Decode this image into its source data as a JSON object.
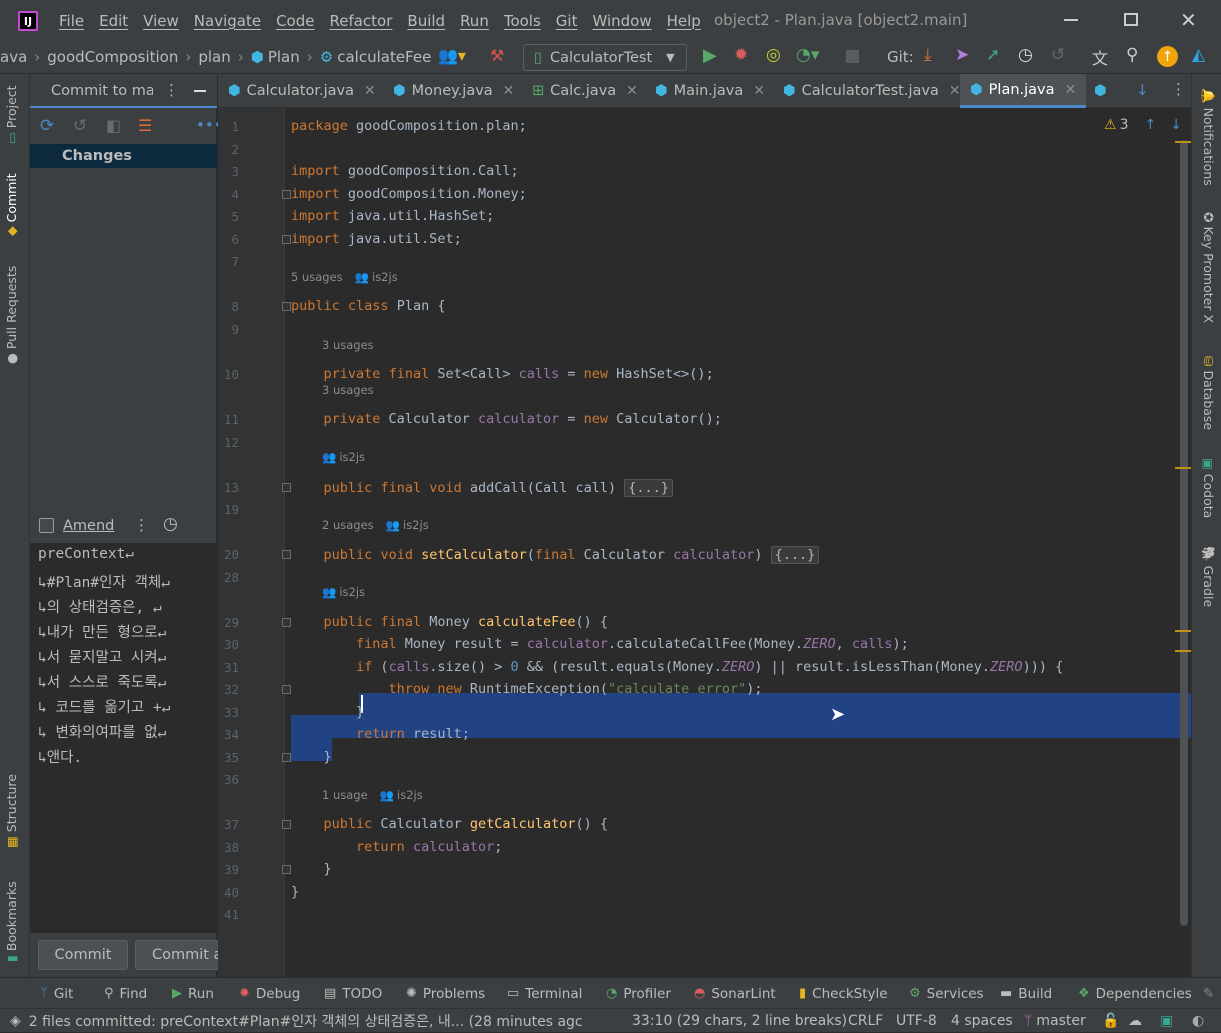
{
  "window": {
    "title": "object2 - Plan.java [object2.main]"
  },
  "menu": [
    "File",
    "Edit",
    "View",
    "Navigate",
    "Code",
    "Refactor",
    "Build",
    "Run",
    "Tools",
    "Git",
    "Window",
    "Help"
  ],
  "breadcrumb": [
    "ava",
    "goodComposition",
    "plan",
    "Plan",
    "calculateFee"
  ],
  "run_config": "CalculatorTest",
  "git_label": "Git:",
  "tabs": {
    "commit_panel_tab": "Commit to ma:",
    "files": [
      "Calculator.java",
      "Money.java",
      "Calc.java",
      "Main.java",
      "CalculatorTest.java",
      "Plan.java"
    ],
    "active": "Plan.java"
  },
  "left_strip": {
    "project": "Project",
    "commit": "Commit",
    "pull_requests": "Pull Requests",
    "structure": "Structure",
    "bookmarks": "Bookmarks"
  },
  "right_strip": {
    "notifications": "Notifications",
    "key_promoter": "Key Promoter X",
    "database": "Database",
    "codota": "Codota",
    "gradle": "Gradle"
  },
  "commit_panel": {
    "changes_label": "Changes",
    "amend_label": "Amend",
    "message_lines": [
      "preContext↵",
      "↳#Plan#인자 객체↵",
      "↳의 상태검증은, ↵",
      "↳내가 만든 형으로↵",
      "↳서 묻지말고 시켜↵",
      "↳서 스스로 죽도록↵",
      "↳ 코드를 옮기고 +↵",
      "↳ 변화의여파를 없↵",
      "↳앤다."
    ],
    "commit_button": "Commit",
    "commit_push_button": "Commit a"
  },
  "editor": {
    "warnings_count": "3",
    "inlay": {
      "usages_5": "5 usages",
      "author": "is2js",
      "usages_3": "3 usages",
      "usages_2": "2 usages",
      "usage_1": "1 usage"
    },
    "lines": [
      {
        "n": "1",
        "t": "package goodComposition.plan;"
      },
      {
        "n": "2",
        "t": ""
      },
      {
        "n": "3",
        "t": "import goodComposition.Call;"
      },
      {
        "n": "4",
        "t": "import goodComposition.Money;"
      },
      {
        "n": "5",
        "t": "import java.util.HashSet;"
      },
      {
        "n": "6",
        "t": "import java.util.Set;"
      },
      {
        "n": "7",
        "t": ""
      },
      {
        "n": "8",
        "t": "public class Plan {"
      },
      {
        "n": "9",
        "t": ""
      },
      {
        "n": "10",
        "t": "    private final Set<Call> calls = new HashSet<>();"
      },
      {
        "n": "11",
        "t": "    private Calculator calculator = new Calculator();"
      },
      {
        "n": "12",
        "t": ""
      },
      {
        "n": "13",
        "t": "    public final void addCall(Call call) {...}"
      },
      {
        "n": "19",
        "t": ""
      },
      {
        "n": "20",
        "t": "    public void setCalculator(final Calculator calculator) {...}"
      },
      {
        "n": "28",
        "t": ""
      },
      {
        "n": "29",
        "t": "    public final Money calculateFee() {"
      },
      {
        "n": "30",
        "t": "        final Money result = calculator.calculateCallFee(Money.ZERO, calls);"
      },
      {
        "n": "31",
        "t": "        if (calls.size() > 0 && (result.equals(Money.ZERO) || result.isLessThan(Money.ZERO))) {"
      },
      {
        "n": "32",
        "t": "            throw new RuntimeException(\"calculate error\");"
      },
      {
        "n": "33",
        "t": "        }"
      },
      {
        "n": "34",
        "t": "        return result;"
      },
      {
        "n": "35",
        "t": "    }"
      },
      {
        "n": "36",
        "t": ""
      },
      {
        "n": "37",
        "t": "    public Calculator getCalculator() {"
      },
      {
        "n": "38",
        "t": "        return calculator;"
      },
      {
        "n": "39",
        "t": "    }"
      },
      {
        "n": "40",
        "t": "}"
      },
      {
        "n": "41",
        "t": ""
      }
    ]
  },
  "tool_windows": [
    "Git",
    "Find",
    "Run",
    "Debug",
    "TODO",
    "Problems",
    "Terminal",
    "Profiler",
    "SonarLint",
    "CheckStyle",
    "Services",
    "Build",
    "Dependencies"
  ],
  "status": {
    "message": "2 files committed: preContext#Plan#인자 객체의 상태검증은, 내... (28 minutes agc",
    "position": "33:10 (29 chars, 2 line breaks)",
    "line_sep": "CRLF",
    "encoding": "UTF-8",
    "indent": "4 spaces",
    "branch": "master"
  },
  "colors": {
    "accent": "#4a88c7",
    "selection": "#214283",
    "keyword": "#cc7832",
    "string": "#6a8759",
    "field": "#9876aa",
    "method": "#ffc66d",
    "number": "#6897bb"
  }
}
